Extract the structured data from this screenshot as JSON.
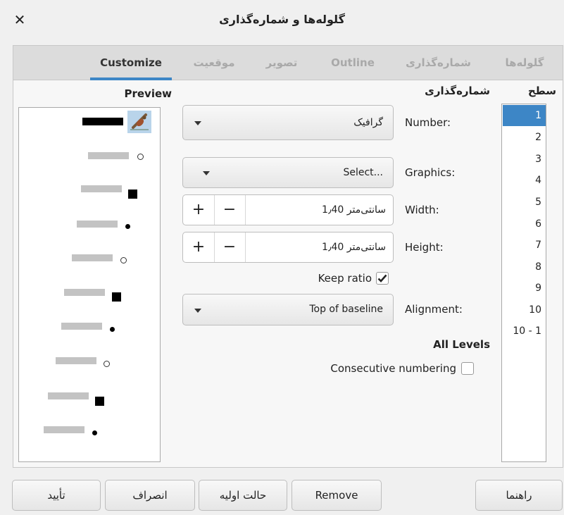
{
  "window": {
    "title": "گلوله‌ها و شماره‌گذاری"
  },
  "tabs": [
    {
      "label": "گلوله‌ها",
      "active": false
    },
    {
      "label": "شماره‌گذاری",
      "active": false
    },
    {
      "label": "Outline",
      "active": false
    },
    {
      "label": "تصویر",
      "active": false
    },
    {
      "label": "موقعیت",
      "active": false
    },
    {
      "label": "Customize",
      "active": true
    }
  ],
  "level": {
    "heading": "سطح",
    "items": [
      "1",
      "2",
      "3",
      "4",
      "5",
      "6",
      "7",
      "8",
      "9",
      "10",
      "10 - 1"
    ],
    "selected": "1"
  },
  "numbering": {
    "heading": "شماره‌گذاری",
    "number_label": "Number:",
    "number_value": "گرافیک",
    "graphics_label": "Graphics:",
    "graphics_value": "Select...",
    "width_label": "Width:",
    "width_value": "1٫40 سانتی‌متر",
    "height_label": "Height:",
    "height_value": "1٫40 سانتی‌متر",
    "keep_ratio_label": "Keep ratio",
    "keep_ratio_checked": true,
    "alignment_label": "Alignment:",
    "alignment_value": "Top of baseline"
  },
  "all_levels": {
    "heading": "All Levels",
    "consecutive_label": "Consecutive numbering",
    "consecutive_checked": false
  },
  "preview": {
    "heading": "Preview",
    "bullets": [
      "graphic",
      "circle",
      "square",
      "dot",
      "circle",
      "square",
      "dot",
      "circle",
      "square",
      "dot"
    ]
  },
  "footer": {
    "help": "راهنما",
    "remove": "Remove",
    "reset": "حالت اولیه",
    "cancel": "انصراف",
    "ok": "تأیید"
  },
  "colors": {
    "accent": "#3d86c6",
    "tab_bg": "#dcdcdc"
  },
  "icons": {
    "close": "close-icon",
    "plus": "plus-icon",
    "minus": "minus-icon",
    "dropdown": "chevron-down-icon",
    "check": "check-icon"
  }
}
